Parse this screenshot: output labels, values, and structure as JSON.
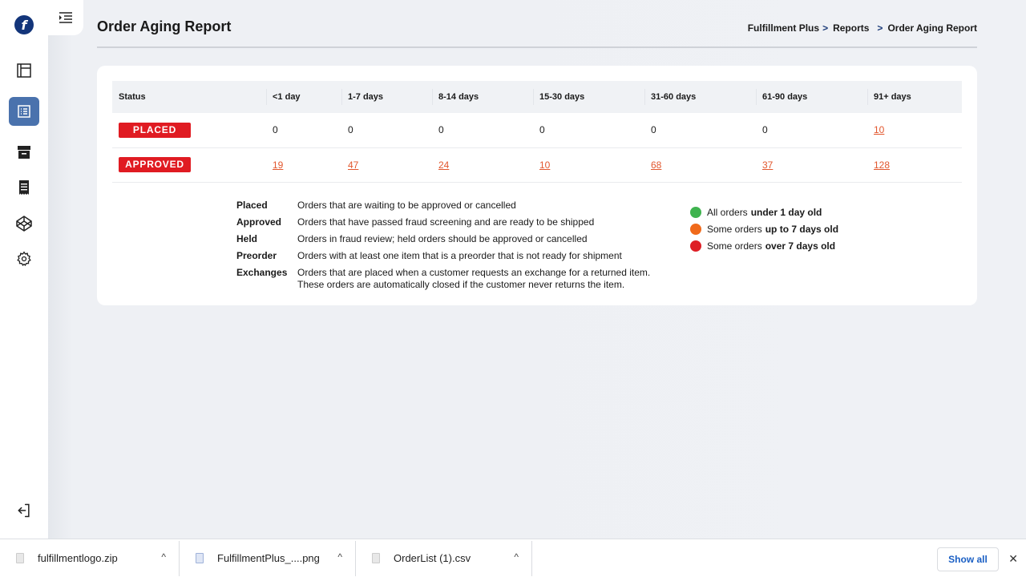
{
  "sidebar": {
    "logo_letter": "f",
    "items": [
      {
        "name": "dashboard",
        "icon": "layout-panel-icon",
        "active": false
      },
      {
        "name": "reports",
        "icon": "list-document-icon",
        "active": true
      },
      {
        "name": "archive",
        "icon": "archive-box-icon",
        "active": false
      },
      {
        "name": "receipts",
        "icon": "receipt-icon",
        "active": false
      },
      {
        "name": "products",
        "icon": "codepen-cube-icon",
        "active": false
      },
      {
        "name": "settings",
        "icon": "gear-icon",
        "active": false
      }
    ],
    "logout_icon": "logout-icon"
  },
  "header": {
    "title": "Order Aging Report",
    "breadcrumb": [
      {
        "label": "Fulfillment Plus"
      },
      {
        "label": "Reports"
      },
      {
        "label": "Order Aging Report"
      }
    ],
    "separator": ">"
  },
  "table": {
    "columns": [
      "Status",
      "<1 day",
      "1-7 days",
      "8-14 days",
      "15-30 days",
      "31-60 days",
      "61-90 days",
      "91+ days"
    ],
    "rows": [
      {
        "status": "PLACED",
        "values": [
          "0",
          "0",
          "0",
          "0",
          "0",
          "0",
          "10"
        ],
        "links": [
          false,
          false,
          false,
          false,
          false,
          false,
          true
        ]
      },
      {
        "status": "APPROVED",
        "values": [
          "19",
          "47",
          "24",
          "10",
          "68",
          "37",
          "128"
        ],
        "links": [
          true,
          true,
          true,
          true,
          true,
          true,
          true
        ]
      }
    ]
  },
  "definitions": [
    {
      "term": "Placed",
      "desc": "Orders that are waiting to be approved or cancelled"
    },
    {
      "term": "Approved",
      "desc": "Orders that have passed fraud screening and are ready to be shipped"
    },
    {
      "term": "Held",
      "desc": "Orders in fraud review; held orders should be approved or cancelled"
    },
    {
      "term": "Preorder",
      "desc": "Orders with at least one item that is a preorder that is not ready for shipment"
    },
    {
      "term": "Exchanges",
      "desc": "Orders that are placed when a customer requests an exchange for a returned item. These orders are automatically closed if the customer never returns the item."
    }
  ],
  "legend": [
    {
      "color": "#3fb34f",
      "prefix": "All orders",
      "bold": "under 1 day old"
    },
    {
      "color": "#f06a1b",
      "prefix": "Some orders",
      "bold": "up to 7 days old"
    },
    {
      "color": "#de1f26",
      "prefix": "Some orders",
      "bold": "over 7 days old"
    }
  ],
  "colors": {
    "badge": "#e01b22",
    "link": "#e2572e",
    "active_nav": "#4a72ad",
    "brand": "#13357a"
  },
  "downloads": {
    "items": [
      {
        "name": "fulfillmentlogo.zip"
      },
      {
        "name": "FulfillmentPlus_....png"
      },
      {
        "name": "OrderList (1).csv"
      }
    ],
    "caret": "^",
    "show_all_label": "Show all",
    "close_label": "✕"
  }
}
